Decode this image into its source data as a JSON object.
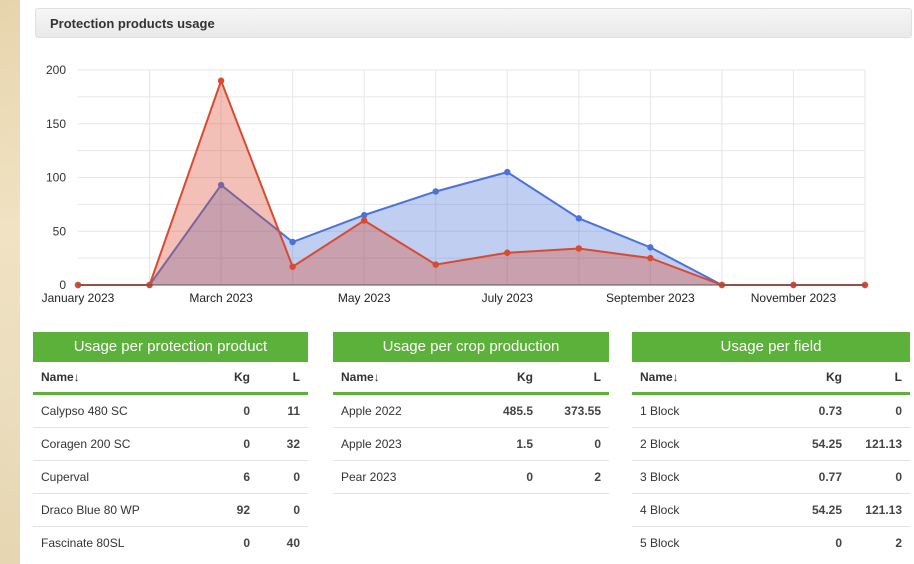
{
  "panel_title": "Protection products usage",
  "colors": {
    "red": "#d94a2f",
    "blue": "#4a72d9",
    "green": "#5cb13b"
  },
  "chart_data": {
    "type": "area",
    "x": [
      "January 2023",
      "February 2023",
      "March 2023",
      "April 2023",
      "May 2023",
      "June 2023",
      "July 2023",
      "August 2023",
      "September 2023",
      "October 2023",
      "November 2023",
      "December 2023"
    ],
    "x_tick_labels": [
      "January 2023",
      "March 2023",
      "May 2023",
      "July 2023",
      "September 2023",
      "November 2023"
    ],
    "y_ticks": [
      "0",
      "50",
      "100",
      "150",
      "200"
    ],
    "ylim": [
      0,
      200
    ],
    "series": [
      {
        "color": "#4a72d9",
        "values": [
          0,
          0,
          93,
          40,
          65,
          87,
          105,
          62,
          35,
          0,
          0,
          0
        ]
      },
      {
        "color": "#d94a2f",
        "values": [
          0,
          0,
          190,
          17,
          60,
          19,
          30,
          34,
          25,
          0,
          0,
          0
        ]
      }
    ]
  },
  "tables": [
    {
      "title": "Usage per protection product",
      "headers": [
        "Name↓",
        "Kg",
        "L"
      ],
      "rows": [
        [
          "Calypso 480 SC",
          "0",
          "11"
        ],
        [
          "Coragen 200 SC",
          "0",
          "32"
        ],
        [
          "Cuperval",
          "6",
          "0"
        ],
        [
          "Draco Blue 80 WP",
          "92",
          "0"
        ],
        [
          "Fascinate 80SL",
          "0",
          "40"
        ]
      ]
    },
    {
      "title": "Usage per crop production",
      "headers": [
        "Name↓",
        "Kg",
        "L"
      ],
      "rows": [
        [
          "Apple 2022",
          "485.5",
          "373.55"
        ],
        [
          "Apple 2023",
          "1.5",
          "0"
        ],
        [
          "Pear 2023",
          "0",
          "2"
        ]
      ]
    },
    {
      "title": "Usage per field",
      "headers": [
        "Name↓",
        "Kg",
        "L"
      ],
      "rows": [
        [
          "1 Block",
          "0.73",
          "0"
        ],
        [
          "2 Block",
          "54.25",
          "121.13"
        ],
        [
          "3 Block",
          "0.77",
          "0"
        ],
        [
          "4 Block",
          "54.25",
          "121.13"
        ],
        [
          "5 Block",
          "0",
          "2"
        ]
      ]
    }
  ]
}
